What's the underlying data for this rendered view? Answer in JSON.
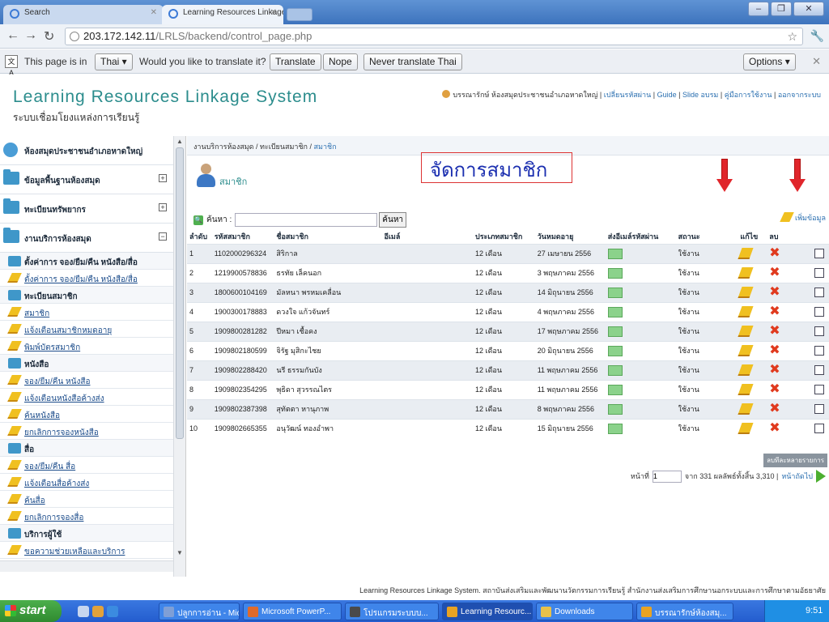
{
  "browser": {
    "tabs": [
      {
        "label": "Search"
      },
      {
        "label": "Learning Resources Linkage Sy"
      }
    ],
    "url_host": "203.172.142.11",
    "url_path": "/LRLS/backend/control_page.php",
    "translate_bar": {
      "text1": "This page is in",
      "lang": "Thai ▾",
      "text2": "Would you like to translate it?",
      "translate": "Translate",
      "nope": "Nope",
      "never": "Never translate Thai",
      "options": "Options ▾"
    }
  },
  "header": {
    "brand": "Learning Resources Linkage System",
    "brand_sub": "ระบบเชื่อมโยงแหล่งการเรียนรู้",
    "user": "บรรณารักษ์ ห้องสมุดประชาชนอำเภอหาดใหญ่",
    "links": [
      "เปลี่ยนรหัสผ่าน",
      "Guide",
      "Slide อบรม",
      "คู่มือการใช้งาน",
      "ออกจากระบบ"
    ]
  },
  "sidebar": {
    "sections": [
      {
        "label": "ห้องสมุดประชาชนอำเภอหาดใหญ่",
        "toggle": "^"
      },
      {
        "label": "ข้อมูลพื้นฐานห้องสมุด",
        "toggle": "+"
      },
      {
        "label": "ทะเบียนทรัพยากร",
        "toggle": "+"
      },
      {
        "label": "งานบริการห้องสมุด",
        "toggle": "−"
      }
    ],
    "items": [
      {
        "type": "group",
        "label": "ตั้งค่าการ จอง/ยืม/คืน หนังสือ/สื่อ"
      },
      {
        "type": "link",
        "label": "ตั้งค่าการ จอง/ยืม/คืน หนังสือ/สื่อ"
      },
      {
        "type": "group",
        "label": "ทะเบียนสมาชิก"
      },
      {
        "type": "link",
        "label": "สมาชิก"
      },
      {
        "type": "link",
        "label": "แจ้งเตือนสมาชิกหมดอายุ"
      },
      {
        "type": "link",
        "label": "พิมพ์บัตรสมาชิก"
      },
      {
        "type": "group",
        "label": "หนังสือ"
      },
      {
        "type": "link",
        "label": "จอง/ยืม/คืน หนังสือ"
      },
      {
        "type": "link",
        "label": "แจ้งเตือนหนังสือค้างส่ง"
      },
      {
        "type": "link",
        "label": "ค้นหนังสือ"
      },
      {
        "type": "link",
        "label": "ยกเลิกการจองหนังสือ"
      },
      {
        "type": "group",
        "label": "สื่อ"
      },
      {
        "type": "link",
        "label": "จอง/ยืม/คืน สื่อ"
      },
      {
        "type": "link",
        "label": "แจ้งเตือนสื่อค้างส่ง"
      },
      {
        "type": "link",
        "label": "ค้นสื่อ"
      },
      {
        "type": "link",
        "label": "ยกเลิกการจองสื่อ"
      },
      {
        "type": "group",
        "label": "บริการผู้ใช้"
      },
      {
        "type": "link",
        "label": "ขอความช่วยเหลือและบริการ"
      }
    ]
  },
  "main": {
    "crumb_prefix": "งานบริการห้องสมุด / ทะเบียนสมาชิก / ",
    "crumb_current": "สมาชิก",
    "title": "สมาชิก",
    "annotation": "จัดการสมาชิก",
    "search_label": "ค้นหา :",
    "search_button": "ค้นหา",
    "add_label": "เพิ่มข้อมูล",
    "columns": [
      "ลำดับ",
      "รหัสสมาชิก",
      "ชื่อสมาชิก",
      "อีเมล์",
      "ประเภทสมาชิก",
      "วันหมดอายุ",
      "ส่งอีเมล์รหัสผ่าน",
      "สถานะ",
      "แก้ไข",
      "ลบ",
      ""
    ],
    "rows": [
      {
        "no": "1",
        "id": "1102000296324",
        "name": "สิริกาล",
        "email": "",
        "type": "12 เดือน",
        "expire": "27 เมษายน 2556",
        "status": "ใช้งาน"
      },
      {
        "no": "2",
        "id": "1219900578836",
        "name": "ธรทัย เล็คนอก",
        "email": "",
        "type": "12 เดือน",
        "expire": "3 พฤษภาคม 2556",
        "status": "ใช้งาน"
      },
      {
        "no": "3",
        "id": "1800600104169",
        "name": "มัลหนา พรหมเคลื่อน",
        "email": "",
        "type": "12 เดือน",
        "expire": "14 มิถุนายน 2556",
        "status": "ใช้งาน"
      },
      {
        "no": "4",
        "id": "1900300178883",
        "name": "ดวงใจ แก้วจันทร์",
        "email": "",
        "type": "12 เดือน",
        "expire": "4 พฤษภาคม 2556",
        "status": "ใช้งาน"
      },
      {
        "no": "5",
        "id": "1909800281282",
        "name": "ปีหมา เชื้อคง",
        "email": "",
        "type": "12 เดือน",
        "expire": "17 พฤษภาคม 2556",
        "status": "ใช้งาน"
      },
      {
        "no": "6",
        "id": "1909802180599",
        "name": "จิรัฐ มุสิกะไชย",
        "email": "",
        "type": "12 เดือน",
        "expire": "20 มิถุนายน 2556",
        "status": "ใช้งาน"
      },
      {
        "no": "7",
        "id": "1909802288420",
        "name": "นรี ธรรมกันบัง",
        "email": "",
        "type": "12 เดือน",
        "expire": "11 พฤษภาคม 2556",
        "status": "ใช้งาน"
      },
      {
        "no": "8",
        "id": "1909802354295",
        "name": "พุธิดา สุวรรณไตร",
        "email": "",
        "type": "12 เดือน",
        "expire": "11 พฤษภาคม 2556",
        "status": "ใช้งาน"
      },
      {
        "no": "9",
        "id": "1909802387398",
        "name": "สุทัตตา หานุภาพ",
        "email": "",
        "type": "12 เดือน",
        "expire": "8 พฤษภาคม 2556",
        "status": "ใช้งาน"
      },
      {
        "no": "10",
        "id": "1909802665355",
        "name": "อนุวัฒน์ ทองอำพา",
        "email": "",
        "type": "12 เดือน",
        "expire": "15 มิถุนายน 2556",
        "status": "ใช้งาน"
      }
    ],
    "delete_multi": "ลบทีละหลายรายการ",
    "pager": {
      "page_label": "หน้าที่",
      "page_value": "1",
      "total_pages": "จาก 331",
      "total_results": "ผลลัพธ์ทั้งสิ้น 3,310",
      "sep": "|",
      "next": "หน้าถัดไป"
    },
    "footer": "Learning Resources Linkage System. สถาบันส่งเสริมและพัฒนานวัตกรรมการเรียนรู้ สำนักงานส่งเสริมการศึกษานอกระบบและการศึกษาตามอัธยาศัย"
  },
  "taskbar": {
    "start": "start",
    "tasks": [
      "ปลูกการอ่าน - Mic...",
      "Microsoft PowerP...",
      "โปรแกรมระบบบ...",
      "Learning Resourc...",
      "Downloads",
      "บรรณารักษ์ห้องสมุ..."
    ],
    "clock": "9:51"
  }
}
